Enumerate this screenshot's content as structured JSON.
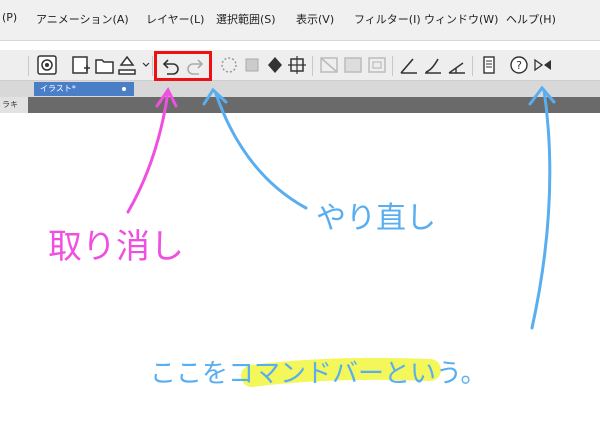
{
  "menu": {
    "items": [
      {
        "label": "(P)"
      },
      {
        "label": "アニメーション(A)"
      },
      {
        "label": "レイヤー(L)"
      },
      {
        "label": "選択範囲(S)"
      },
      {
        "label": "表示(V)"
      },
      {
        "label": "フィルター(I)"
      },
      {
        "label": "ウィンドウ(W)"
      },
      {
        "label": "ヘルプ(H)"
      }
    ]
  },
  "toolbar": {
    "icons": [
      "clip-studio-icon",
      "new-file-icon",
      "open-file-icon",
      "save-icon",
      "undo-icon",
      "redo-icon",
      "clear-selection-icon",
      "fill-icon",
      "transform-icon",
      "crop-icon",
      "deselect-icon",
      "convert-icon",
      "frame-icon",
      "ruler-snap-icon",
      "curve-snap-icon",
      "angle-snap-icon",
      "panel-icon",
      "help-icon",
      "flip-icon"
    ]
  },
  "document_tab": {
    "title": "イラスト*"
  },
  "left_panel": {
    "label": "ラキ"
  },
  "annotations": {
    "undo_label": "取り消し",
    "redo_label": "やり直し",
    "command_bar_note": "ここをコマンドバーという。"
  },
  "colors": {
    "highlight_box": "#ee1111",
    "pink_annotation": "#f050e0",
    "blue_annotation": "#58aef0",
    "marker_yellow": "#f4f75a"
  }
}
